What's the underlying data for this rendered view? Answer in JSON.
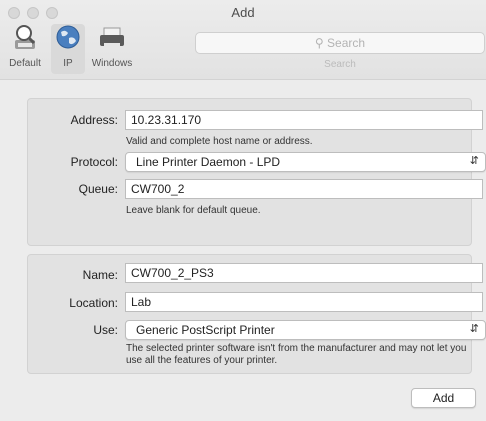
{
  "window": {
    "title": "Add"
  },
  "toolbar": {
    "items": [
      {
        "label": "Default",
        "icon": "default-printers-icon"
      },
      {
        "label": "IP",
        "icon": "globe-icon",
        "selected": true
      },
      {
        "label": "Windows",
        "icon": "windows-printer-icon"
      }
    ],
    "search": {
      "placeholder": "Search",
      "label": "Search"
    }
  },
  "address_section": {
    "address_label": "Address:",
    "address_value": "10.23.31.170",
    "address_hint": "Valid and complete host name or address.",
    "protocol_label": "Protocol:",
    "protocol_value": "Line Printer Daemon - LPD",
    "queue_label": "Queue:",
    "queue_value": "CW700_2",
    "queue_hint": "Leave blank for default queue."
  },
  "printer_section": {
    "name_label": "Name:",
    "name_value": "CW700_2_PS3",
    "location_label": "Location:",
    "location_value": "Lab",
    "use_label": "Use:",
    "use_value": "Generic PostScript Printer",
    "use_hint": "The selected printer software isn't from the manufacturer and may not let you use all the features of your printer."
  },
  "footer": {
    "add_label": "Add"
  }
}
